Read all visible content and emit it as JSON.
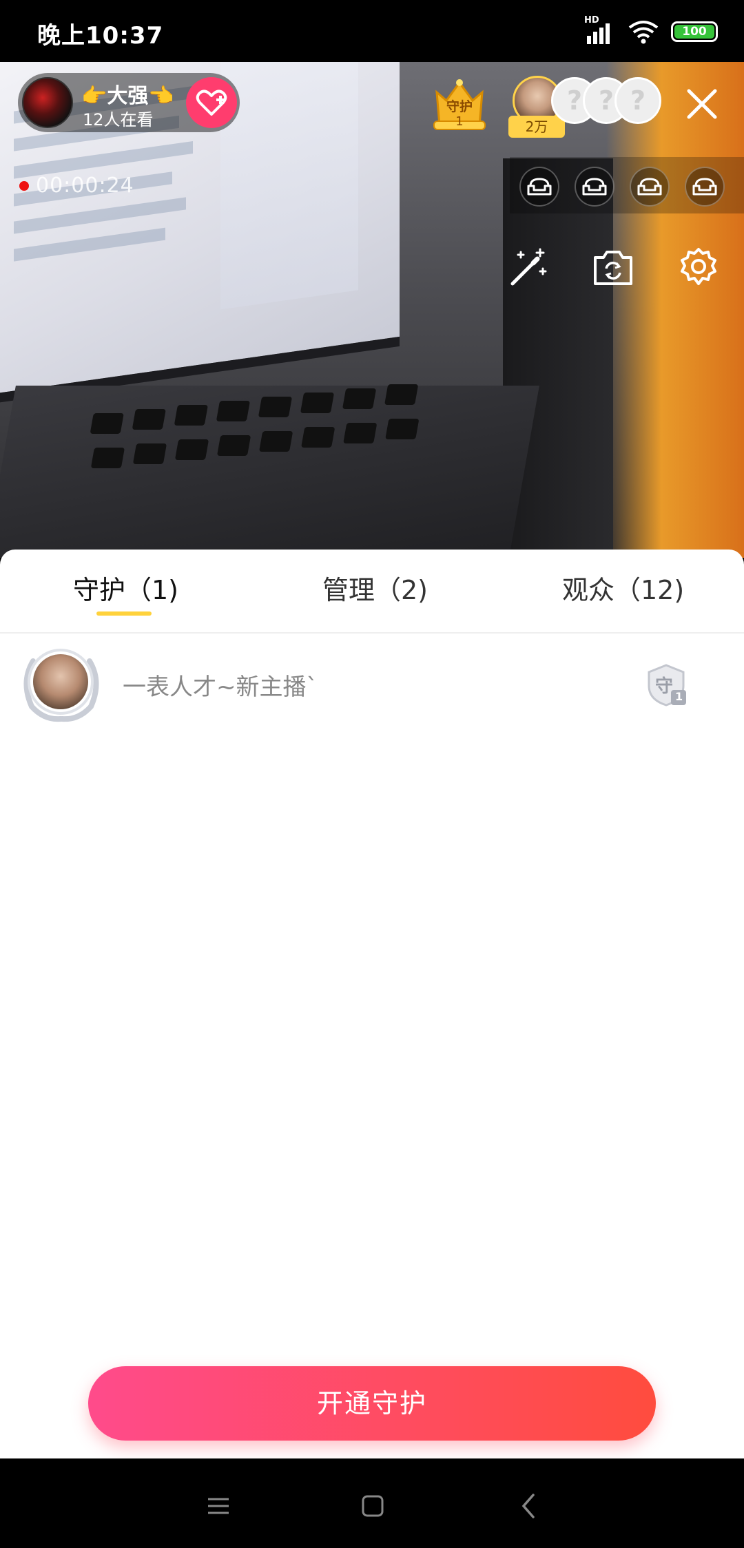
{
  "status_bar": {
    "time": "晚上10:37",
    "network_label": "HD",
    "battery": "100"
  },
  "host": {
    "name": "👉大强👈",
    "viewers": "12人在看"
  },
  "live": {
    "timer": "00:00:24"
  },
  "guard_badge": {
    "label": "守护",
    "count": "1"
  },
  "top_fan": {
    "amount": "2万"
  },
  "empty_seat_mark": "?",
  "tabs": [
    {
      "label": "守护（1)",
      "active": true
    },
    {
      "label": "管理（2)",
      "active": false
    },
    {
      "label": "观众（12)",
      "active": false
    }
  ],
  "members": [
    {
      "name": "一表人才~新主播`",
      "badge_text": "守",
      "badge_level": "1"
    }
  ],
  "action": {
    "open_guard": "开通守护"
  },
  "colors": {
    "accent_pink": "#ff4b8b",
    "accent_red": "#ff4c3e",
    "tab_underline": "#ffd23c",
    "battery_green": "#36c33a"
  }
}
